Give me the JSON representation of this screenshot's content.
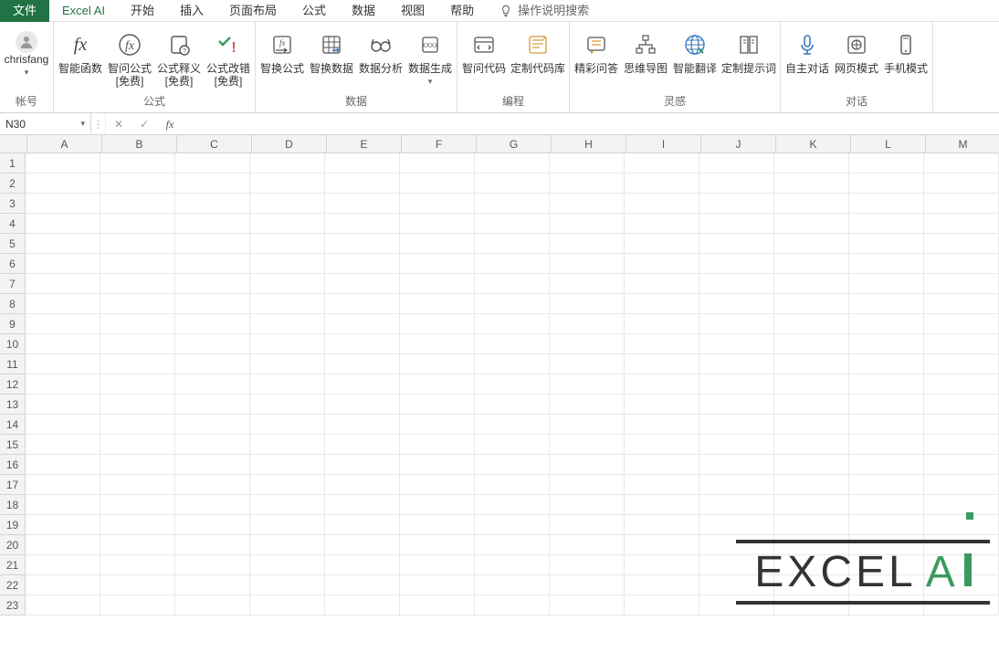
{
  "tabs": {
    "file": "文件",
    "excel_ai": "Excel AI",
    "home": "开始",
    "insert": "插入",
    "page_layout": "页面布局",
    "formulas": "公式",
    "data": "数据",
    "view": "视图",
    "help": "帮助",
    "search": "操作说明搜索"
  },
  "account": {
    "username": "chrisfang",
    "group_label": "帐号"
  },
  "ribbon": {
    "formula_group": {
      "label": "公式",
      "smart_fn": "智能函数",
      "smart_ask": {
        "line1": "智问公式",
        "line2": "[免费]"
      },
      "explain": {
        "line1": "公式释义",
        "line2": "[免费]"
      },
      "fix": {
        "line1": "公式改错",
        "line2": "[免费]"
      }
    },
    "data_group": {
      "label": "数据",
      "swap_formula": "智换公式",
      "swap_data": "智换数据",
      "analyze": "数据分析",
      "generate": "数据生成"
    },
    "coding_group": {
      "label": "编程",
      "ask_code": "智问代码",
      "code_lib": "定制代码库"
    },
    "inspire_group": {
      "label": "灵感",
      "qa": "精彩问答",
      "mindmap": "思维导图",
      "translate": "智能翻译",
      "prompts": "定制提示词"
    },
    "dialog_group": {
      "label": "对话",
      "auto": "自主对话",
      "web": "网页模式",
      "mobile": "手机模式"
    }
  },
  "formula_bar": {
    "name_box": "N30",
    "fx": "fx"
  },
  "grid": {
    "columns": [
      "A",
      "B",
      "C",
      "D",
      "E",
      "F",
      "G",
      "H",
      "I",
      "J",
      "K",
      "L",
      "M"
    ],
    "rows": [
      1,
      2,
      3,
      4,
      5,
      6,
      7,
      8,
      9,
      10,
      11,
      12,
      13,
      14,
      15,
      16,
      17,
      18,
      19,
      20,
      21,
      22,
      23
    ]
  },
  "watermark": {
    "brand": "EXCEL",
    "suffix": "A"
  }
}
